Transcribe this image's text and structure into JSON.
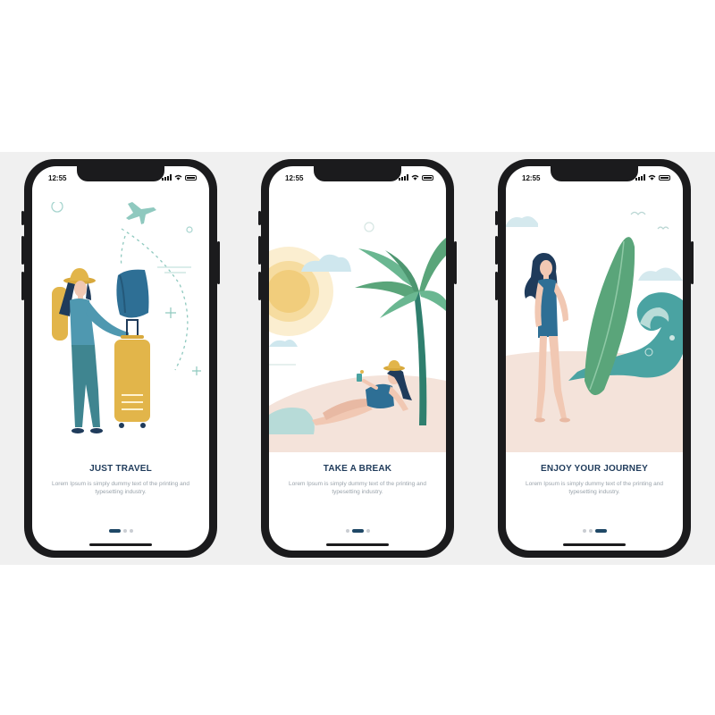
{
  "screens": [
    {
      "time": "12:55",
      "title": "JUST TRAVEL",
      "description": "Lorem Ipsum is simply dummy text of the printing and typesetting industry.",
      "page_index": 0,
      "page_count": 3,
      "illustration": "traveler-with-suitcase"
    },
    {
      "time": "12:55",
      "title": "TAKE A BREAK",
      "description": "Lorem Ipsum is simply dummy text of the printing and typesetting industry.",
      "page_index": 1,
      "page_count": 3,
      "illustration": "beach-palm-tree"
    },
    {
      "time": "12:55",
      "title": "ENJOY YOUR JOURNEY",
      "description": "Lorem Ipsum is simply dummy text of the printing and typesetting industry.",
      "page_index": 2,
      "page_count": 3,
      "illustration": "surfer-with-board"
    }
  ],
  "colors": {
    "title": "#1f3b5b",
    "active_dot": "#1f4866",
    "inactive_dot": "#c9cdd2",
    "teal": "#4aa3a2",
    "mustard": "#e2b54a",
    "green": "#5aa57a",
    "sand": "#f4e3da"
  }
}
